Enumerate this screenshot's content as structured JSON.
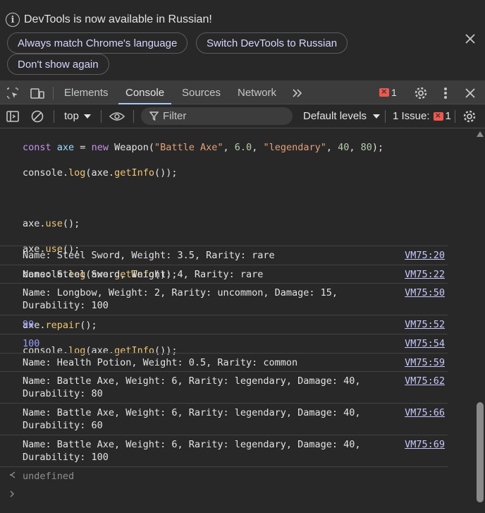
{
  "infobar": {
    "message": "DevTools is now available in Russian!",
    "buttons": {
      "always_match": "Always match Chrome's language",
      "switch": "Switch DevTools to Russian",
      "dont_show": "Don't show again"
    },
    "info_icon": "info-icon",
    "close_icon": "close-icon"
  },
  "toolbar": {
    "tabs": [
      "Elements",
      "Console",
      "Sources",
      "Network"
    ],
    "active_tab": "Console",
    "more_tabs_icon": "chevron-double-right-icon",
    "error_count": "1",
    "icons": [
      "inspect-element-icon",
      "device-toolbar-icon",
      "error-icon",
      "gear-icon",
      "more-vert-icon",
      "close-icon"
    ]
  },
  "console_toolbar": {
    "context": "top",
    "filter_placeholder": "Filter",
    "levels": "Default levels",
    "issues_label": "1 Issue:",
    "issues_count": "1",
    "icons": [
      "sidebar-icon",
      "clear-console-icon",
      "eye-icon",
      "filter-icon",
      "gear-icon"
    ]
  },
  "code": {
    "lines": [
      "const axe = new Weapon(\"Battle Axe\", 6.0, \"legendary\", 40, 80);",
      "console.log(axe.getInfo());",
      "",
      "axe.use();",
      "axe.use();",
      "console.log(axe.getInfo());",
      "",
      "axe.repair();",
      "console.log(axe.getInfo());"
    ]
  },
  "logs": [
    {
      "text": "Name: Steel Sword, Weight: 3.5, Rarity: rare",
      "source": "VM75:20",
      "type": "text"
    },
    {
      "text": "Name: Steel Sword, Weight: 4, Rarity: rare",
      "source": "VM75:22",
      "type": "text"
    },
    {
      "text": "Name: Longbow, Weight: 2, Rarity: uncommon, Damage: 15,\nDurability: 100",
      "source": "VM75:50",
      "type": "text"
    },
    {
      "text": "90",
      "source": "VM75:52",
      "type": "number"
    },
    {
      "text": "100",
      "source": "VM75:54",
      "type": "number"
    },
    {
      "text": "Name: Health Potion, Weight: 0.5, Rarity: common",
      "source": "VM75:59",
      "type": "text"
    },
    {
      "text": "Name: Battle Axe, Weight: 6, Rarity: legendary, Damage: 40,\nDurability: 80",
      "source": "VM75:62",
      "type": "text"
    },
    {
      "text": "Name: Battle Axe, Weight: 6, Rarity: legendary, Damage: 40,\nDurability: 60",
      "source": "VM75:66",
      "type": "text"
    },
    {
      "text": "Name: Battle Axe, Weight: 6, Rarity: legendary, Damage: 40,\nDurability: 100",
      "source": "VM75:69",
      "type": "text"
    }
  ],
  "result": {
    "value": "undefined",
    "return_icon": "return-arrow-icon",
    "prompt_icon": "prompt-chevron-icon"
  }
}
